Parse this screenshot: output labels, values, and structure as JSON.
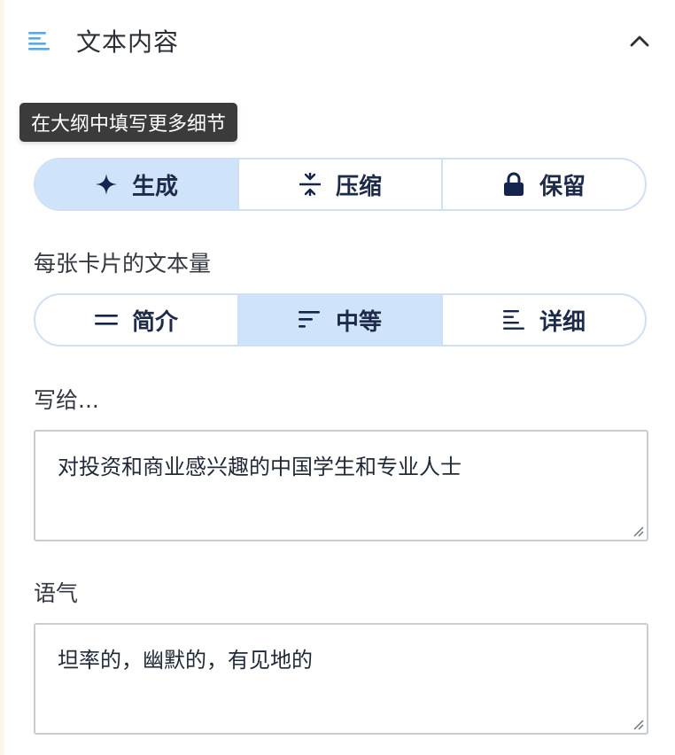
{
  "header": {
    "title": "文本内容",
    "icon": "align-left-lines-icon",
    "collapse_icon": "chevron-up-icon"
  },
  "tooltip": {
    "text": "在大纲中填写更多细节"
  },
  "mode": {
    "options": [
      {
        "label": "生成",
        "icon": "sparkle-icon",
        "selected": true
      },
      {
        "label": "压缩",
        "icon": "compress-icon",
        "selected": false
      },
      {
        "label": "保留",
        "icon": "lock-icon",
        "selected": false
      }
    ]
  },
  "text_amount": {
    "label": "每张卡片的文本量",
    "options": [
      {
        "label": "简介",
        "icon": "two-lines-icon",
        "selected": false
      },
      {
        "label": "中等",
        "icon": "three-lines-medium-icon",
        "selected": true
      },
      {
        "label": "详细",
        "icon": "four-lines-icon",
        "selected": false
      }
    ]
  },
  "audience": {
    "label": "写给...",
    "value": "对投资和商业感兴趣的中国学生和专业人士"
  },
  "tone": {
    "label": "语气",
    "value": "坦率的，幽默的，有见地的"
  },
  "colors": {
    "accent": "#5aa9e6",
    "active_segment": "#cfe3fb",
    "segment_border": "#cfe0f5",
    "icon_dark": "#14244d",
    "tooltip_bg": "#3b3b3b"
  }
}
